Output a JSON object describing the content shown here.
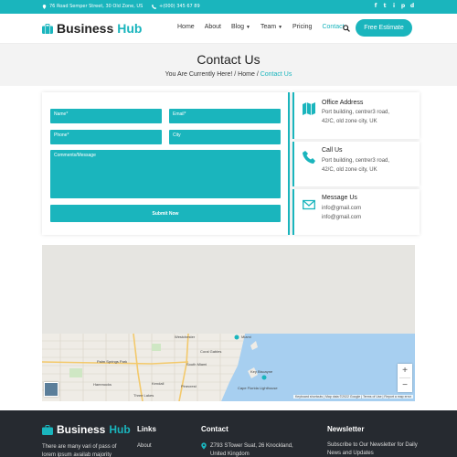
{
  "topbar": {
    "address": "76 Road Semper Street, 30 Old Zone, US",
    "phone": "+(000) 345 67 89",
    "socials": [
      "f",
      "t",
      "i",
      "p",
      "d"
    ]
  },
  "nav": {
    "brand_part1": "Business",
    "brand_part2": "Hub",
    "items": [
      {
        "label": "Home"
      },
      {
        "label": "About"
      },
      {
        "label": "Blog"
      },
      {
        "label": "Team"
      },
      {
        "label": "Pricing"
      },
      {
        "label": "Contact"
      }
    ],
    "cta": "Free Estimate"
  },
  "banner": {
    "title": "Contact Us",
    "prefix": "You Are Currently Here!",
    "sep1": "/",
    "home": "Home",
    "sep2": "/",
    "current": "Contact Us"
  },
  "form": {
    "name_placeholder": "Name*",
    "email_placeholder": "Email*",
    "phone_placeholder": "Phone*",
    "city_placeholder": "City",
    "message_placeholder": "Comments/Message",
    "submit_label": "Submit Now"
  },
  "info": {
    "office": {
      "title": "Office Address",
      "line1": "Port building, centrer3 road,",
      "line2": "42/C, old zone city, UK"
    },
    "call": {
      "title": "Call Us",
      "line1": "Port building, centrer3 road,",
      "line2": "42/C, old zone city, UK"
    },
    "message": {
      "title": "Message Us",
      "line1": "info@gmail.com",
      "line2": "info@gmail.com"
    }
  },
  "map": {
    "labels": [
      "Westchester",
      "Coral Gables",
      "South Miami",
      "Kendall",
      "Pinecrest",
      "Hammocks",
      "Three Lakes",
      "Miami",
      "Palm Springs Park",
      "Key Biscayne",
      "Cape Florida Lighthouse"
    ],
    "zoom_in": "+",
    "zoom_out": "−",
    "attribution": "Keyboard shortcuts | Map data ©2022 Google | Terms of Use | Report a map error"
  },
  "footer": {
    "brand_part1": "Business",
    "brand_part2": "Hub",
    "about": "There are many vari of pass of lorem ipsum availab majority",
    "links_heading": "Links",
    "link1": "About",
    "contact_heading": "Contact",
    "contact_address": "Z793 STower Suat, 26 Knockland, United Kingdom",
    "newsletter_heading": "Newsletter",
    "newsletter_text": "Subscribe to Our Newsletter for Daily News and Updates"
  },
  "colors": {
    "accent": "#1ab5bd",
    "footer_bg": "#262a30",
    "banner_bg": "#f3f3f3"
  }
}
